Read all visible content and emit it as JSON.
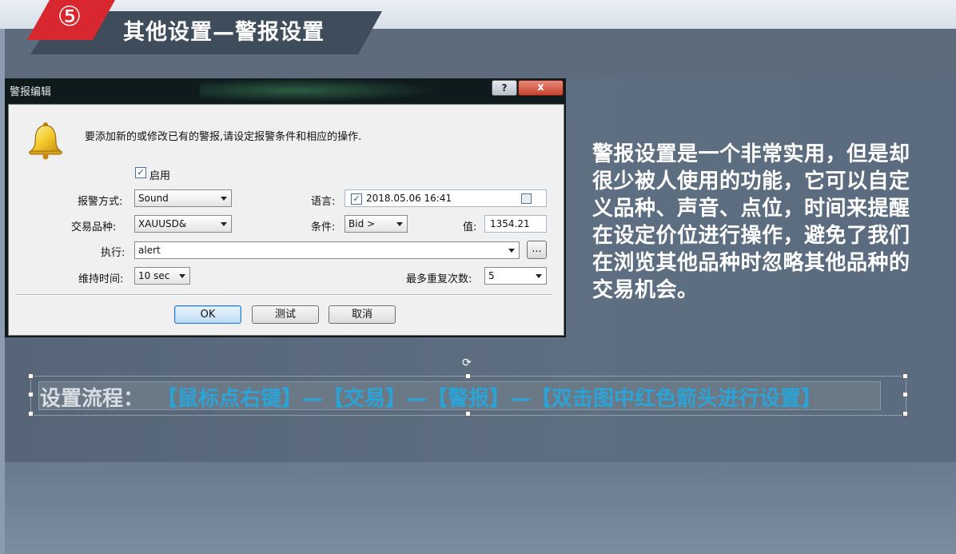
{
  "slide": {
    "step_number": "⑤",
    "title": "其他设置—警报设置"
  },
  "dialog": {
    "title": "警报编辑",
    "help_button": "?",
    "close_button": "x",
    "message": "要添加新的或修改已有的警报,请设定报警条件和相应的操作.",
    "enable": {
      "label": "启用",
      "checked": true
    },
    "alert_type": {
      "label": "报警方式:",
      "value": "Sound"
    },
    "symbol": {
      "label": "交易品种:",
      "value": "XAUUSD&"
    },
    "expiry": {
      "label": "语言:",
      "checked": true,
      "value": "2018.05.06 16:41"
    },
    "condition": {
      "label": "条件:",
      "value": "Bid >"
    },
    "price": {
      "label": "值:",
      "value": "1354.21"
    },
    "action": {
      "label": "执行:",
      "value": "alert",
      "browse": "..."
    },
    "timeout": {
      "label": "维持时间:",
      "value": "10 sec"
    },
    "max_repeats": {
      "label": "最多重复次数:",
      "value": "5"
    },
    "buttons": {
      "ok": "OK",
      "test": "测试",
      "cancel": "取消"
    }
  },
  "description": "警报设置是一个非常实用，但是却很少被人使用的功能，它可以自定义品种、声音、点位，时间来提醒在设定价位进行操作，避免了我们在浏览其他品种时忽略其他品种的交易机会。",
  "flow": {
    "label": "设置流程：",
    "steps": "【鼠标点右键】—【交易】—【警报】—【双击图中红色箭头进行设置】"
  }
}
